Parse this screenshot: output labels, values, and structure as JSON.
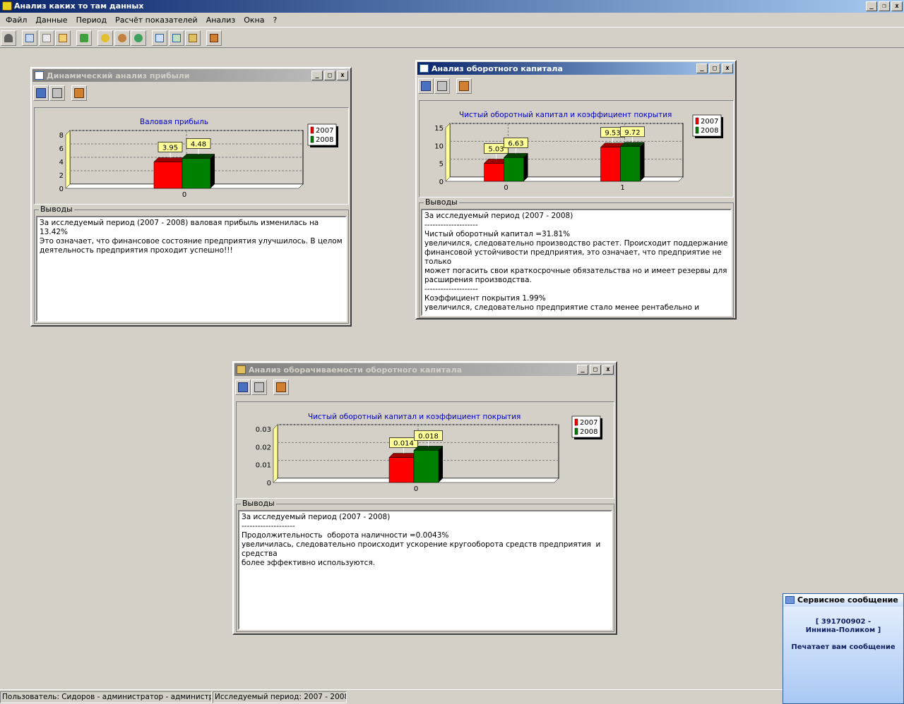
{
  "app": {
    "title": "Анализ каких то там данных"
  },
  "menu": [
    "Файл",
    "Данные",
    "Период",
    "Расчёт показателей",
    "Анализ",
    "Окна",
    "?"
  ],
  "caption_buttons": {
    "min": "_",
    "max": "□",
    "restore": "❐",
    "close": "x"
  },
  "colors": {
    "y2007": "#ff0000",
    "y2008": "#008000",
    "chart_title": "#0000cc",
    "label_bg": "#ffff99"
  },
  "windows": {
    "profit": {
      "title": "Динамический анализ прибыли",
      "chart_title": "Валовая прибыль",
      "group": "Выводы",
      "memo": "За исследуемый период (2007 - 2008) валовая прибыль изменилась на 13.42%\nЭто означает, что финансовое состояние предприятия улучшилось. В целом\nдеятельность предприятия проходит успешно!!!"
    },
    "capital": {
      "title": "Анализ оборотного капитала",
      "chart_title": "Чистый оборотный капитал и коэффициент покрытия",
      "group": "Выводы",
      "memo": "За исследуемый период (2007 - 2008)\n--------------------\nЧистый оборотный капитал =31.81%\nувеличился, следовательно производство растет. Происходит поддержание\nфинансовой устойчивости предприятия, это означает, что предприятие не только\nможет погасить свои краткосрочные обязательства но и имеет резервы для\nрасширения производства.\n--------------------\nКоэффициент покрытия 1.99%\nувеличился, следовательно предприятие стало менее рентабельно и возможно\nпридется взять ненужную банковскую ссуду."
    },
    "turnover": {
      "title": "Анализ оборачиваемости оборотного капитала",
      "chart_title": "Чистый оборотный капитал и коэффициент покрытия",
      "group": "Выводы",
      "memo": "За исследуемый период (2007 - 2008)\n--------------------\nПродолжительность  оборота наличности =0.0043%\nувеличилась, следовательно происходит ускорение кругооборота средств предприятия  и средства\nболее эффективно используются."
    }
  },
  "status": {
    "user": "Пользователь: Сидоров - администратор - администратор",
    "period": "Исследуемый период: 2007 - 2008"
  },
  "popup": {
    "title": "Сервисное сообщение",
    "line1": "[ 391700902 -",
    "line2": "Иннина-Поликом ]",
    "line3": "Печатает вам сообщение"
  },
  "chart_data": [
    {
      "type": "bar",
      "categories": [
        "0"
      ],
      "series": [
        {
          "name": "2007",
          "values": [
            3.95
          ]
        },
        {
          "name": "2008",
          "values": [
            4.48
          ]
        }
      ],
      "title": "Валовая прибыль",
      "ylim": [
        0,
        8
      ],
      "yticks": [
        0,
        2,
        4,
        6,
        8
      ],
      "legend": "right"
    },
    {
      "type": "bar",
      "categories": [
        "0",
        "1"
      ],
      "series": [
        {
          "name": "2007",
          "values": [
            5.03,
            9.53
          ]
        },
        {
          "name": "2008",
          "values": [
            6.63,
            9.72
          ]
        }
      ],
      "title": "Чистый оборотный капитал и коэффициент покрытия",
      "ylim": [
        0,
        15
      ],
      "yticks": [
        0,
        5,
        10,
        15
      ],
      "legend": "right"
    },
    {
      "type": "bar",
      "categories": [
        "0"
      ],
      "series": [
        {
          "name": "2007",
          "values": [
            0.014
          ]
        },
        {
          "name": "2008",
          "values": [
            0.018
          ]
        }
      ],
      "title": "Чистый оборотный капитал и коэффициент покрытия",
      "ylim": [
        0,
        0.03
      ],
      "yticks": [
        0,
        0.01,
        0.02,
        0.03
      ],
      "legend": "right"
    }
  ]
}
